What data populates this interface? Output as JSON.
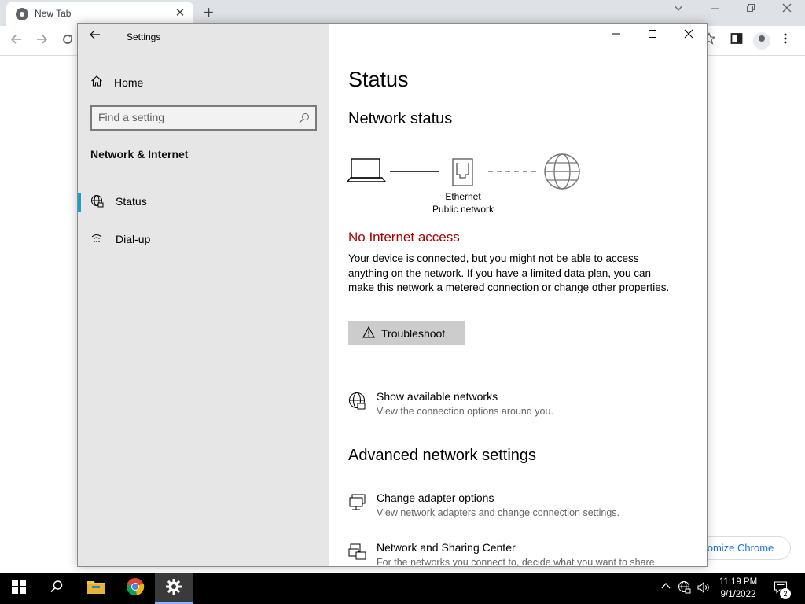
{
  "chrome": {
    "tab_title": "New Tab",
    "tab_close": "✕",
    "new_tab": "+",
    "customize_label": "Customize Chrome"
  },
  "settings": {
    "window_title": "Settings",
    "back": "←",
    "nav": {
      "home_label": "Home",
      "search_placeholder": "Find a setting",
      "section_label": "Network & Internet",
      "items": [
        {
          "label": "Status",
          "icon": "globe-icon",
          "active": true
        },
        {
          "label": "Dial-up",
          "icon": "dialup-icon",
          "active": false
        }
      ]
    },
    "controls": {
      "minimize": "—",
      "maximize": "☐",
      "close": "✕"
    },
    "main": {
      "title": "Status",
      "network_status_heading": "Network status",
      "diagram": {
        "adapter_name": "Ethernet",
        "network_type": "Public network"
      },
      "alert": "No Internet access",
      "description": "Your device is connected, but you might not be able to access anything on the network. If you have a limited data plan, you can make this network a metered connection or change other properties.",
      "troubleshoot_label": "Troubleshoot",
      "show_networks": {
        "title": "Show available networks",
        "subtitle": "View the connection options around you."
      },
      "advanced_heading": "Advanced network settings",
      "adapter_options": {
        "title": "Change adapter options",
        "subtitle": "View network adapters and change connection settings."
      },
      "sharing_center": {
        "title": "Network and Sharing Center",
        "subtitle": "For the networks you connect to, decide what you want to share."
      }
    },
    "colors": {
      "alert": "#a80000",
      "accent": "#1aa0c8",
      "nav_bg": "#e6e6e6"
    }
  },
  "taskbar": {
    "time": "11:19 PM",
    "date": "9/1/2022",
    "notification_count": "2",
    "apps": [
      "start-icon",
      "search-icon",
      "file-explorer-icon",
      "chrome-icon",
      "settings-icon"
    ]
  }
}
